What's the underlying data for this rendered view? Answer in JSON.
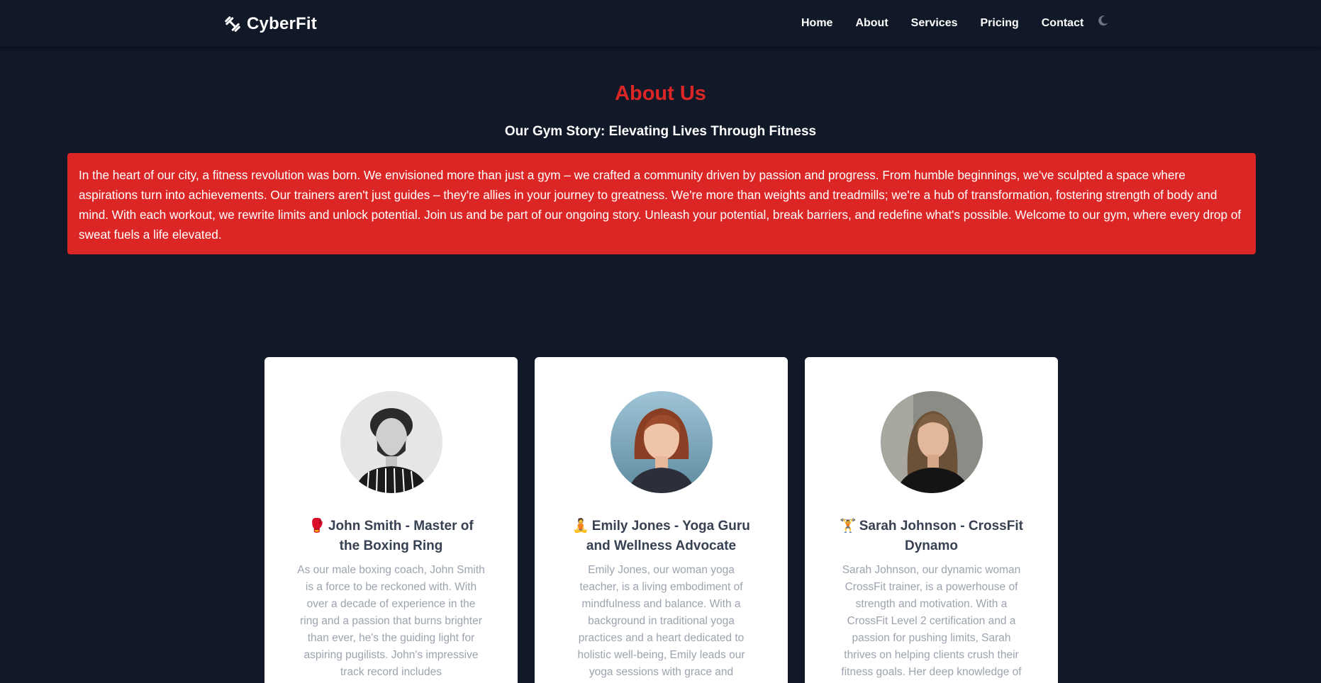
{
  "nav": {
    "brand": "CyberFit",
    "brand_icon": "dumbbell-icon",
    "links": [
      "Home",
      "About",
      "Services",
      "Pricing",
      "Contact"
    ],
    "theme_toggle_icon": "moon-icon"
  },
  "about": {
    "title": "About Us",
    "subtitle": "Our Gym Story: Elevating Lives Through Fitness",
    "story": "In the heart of our city, a fitness revolution was born. We envisioned more than just a gym – we crafted a community driven by passion and progress. From humble beginnings, we've sculpted a space where aspirations turn into achievements. Our trainers aren't just guides – they're allies in your journey to greatness. We're more than weights and treadmills; we're a hub of transformation, fostering strength of body and mind. With each workout, we rewrite limits and unlock potential. Join us and be part of our ongoing story. Unleash your potential, break barriers, and redefine what's possible. Welcome to our gym, where every drop of sweat fuels a life elevated."
  },
  "trainers": [
    {
      "emoji": "🥊",
      "name": "John Smith - Master of the Boxing Ring",
      "bio": "As our male boxing coach, John Smith is a force to be reckoned with. With over a decade of experience in the ring and a passion that burns brighter than ever, he's the guiding light for aspiring pugilists. John's impressive track record includes"
    },
    {
      "emoji": "🧘",
      "name": "Emily Jones - Yoga Guru and Wellness Advocate",
      "bio": "Emily Jones, our woman yoga teacher, is a living embodiment of mindfulness and balance. With a background in traditional yoga practices and a heart dedicated to holistic well-being, Emily leads our yoga sessions with grace and"
    },
    {
      "emoji": "🏋️",
      "name": "Sarah Johnson - CrossFit Dynamo",
      "bio": "Sarah Johnson, our dynamic woman CrossFit trainer, is a powerhouse of strength and motivation. With a CrossFit Level 2 certification and a passion for pushing limits, Sarah thrives on helping clients crush their fitness goals. Her deep knowledge of"
    }
  ],
  "colors": {
    "background": "#111827",
    "accent": "#dc2626",
    "card_bg": "#ffffff",
    "card_title": "#374151",
    "card_text": "#9ca3af"
  }
}
